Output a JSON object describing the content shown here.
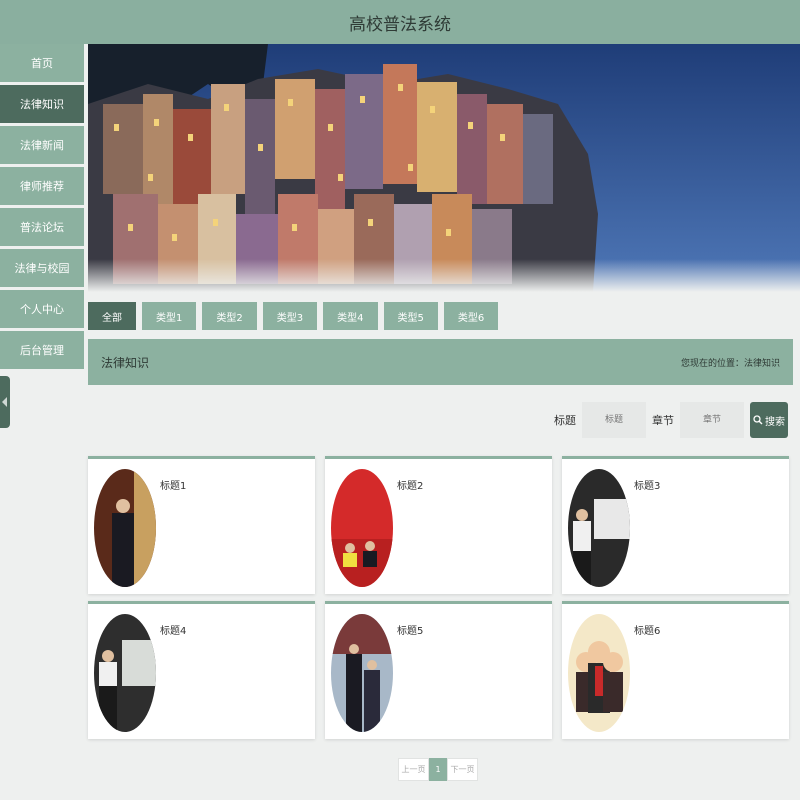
{
  "app": {
    "title": "高校普法系统"
  },
  "sidebar": {
    "items": [
      {
        "label": "首页"
      },
      {
        "label": "法律知识"
      },
      {
        "label": "法律新闻"
      },
      {
        "label": "律师推荐"
      },
      {
        "label": "普法论坛"
      },
      {
        "label": "法律与校园"
      },
      {
        "label": "个人中心"
      },
      {
        "label": "后台管理"
      }
    ],
    "active_index": 1
  },
  "tabs": [
    {
      "label": "全部"
    },
    {
      "label": "类型1"
    },
    {
      "label": "类型2"
    },
    {
      "label": "类型3"
    },
    {
      "label": "类型4"
    },
    {
      "label": "类型5"
    },
    {
      "label": "类型6"
    }
  ],
  "section": {
    "title": "法律知识",
    "breadcrumb": "您现在的位置：法律知识"
  },
  "search": {
    "title_label": "标题",
    "title_placeholder": "标题",
    "chapter_label": "章节",
    "chapter_placeholder": "章节",
    "button_label": "搜索"
  },
  "cards": [
    {
      "title": "标题1"
    },
    {
      "title": "标题2"
    },
    {
      "title": "标题3"
    },
    {
      "title": "标题4"
    },
    {
      "title": "标题5"
    },
    {
      "title": "标题6"
    }
  ],
  "pagination": {
    "prev_label": "上一页",
    "current_page": "1",
    "next_label": "下一页"
  },
  "colors": {
    "primary": "#8cb1a0",
    "primary_dark": "#4d6b5e",
    "background": "#eef0ef"
  }
}
